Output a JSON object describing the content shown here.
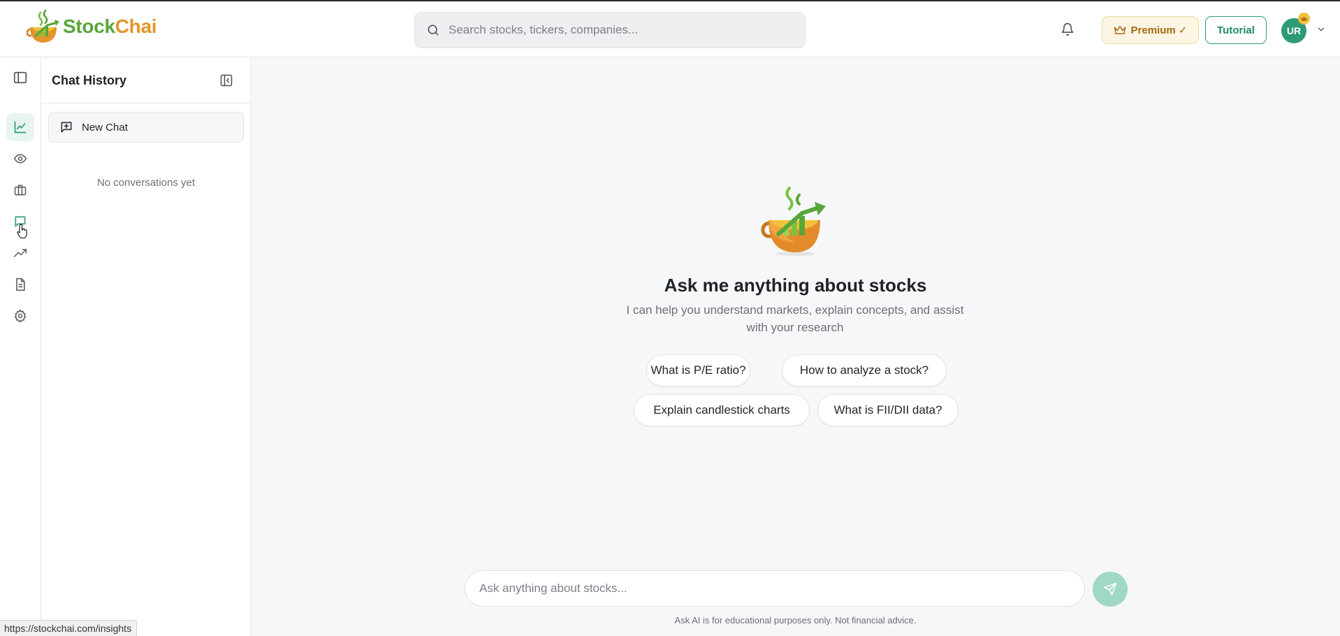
{
  "brand": {
    "name_part1": "Stock",
    "name_part2": "Chai"
  },
  "header": {
    "search_placeholder": "Search stocks, tickers, companies...",
    "premium_label": "Premium ✓",
    "tutorial_label": "Tutorial",
    "avatar_initials": "UR"
  },
  "rail": {
    "items": [
      {
        "icon": "line-chart-icon",
        "active": true
      },
      {
        "icon": "eye-icon",
        "active": false
      },
      {
        "icon": "briefcase-icon",
        "active": false
      },
      {
        "icon": "message-square-icon",
        "active": false,
        "hovered": true
      },
      {
        "icon": "trending-up-icon",
        "active": false
      },
      {
        "icon": "document-icon",
        "active": false
      },
      {
        "icon": "gear-icon",
        "active": false
      }
    ]
  },
  "history": {
    "title": "Chat History",
    "new_chat_label": "New Chat",
    "empty_message": "No conversations yet"
  },
  "main": {
    "title": "Ask me anything about stocks",
    "subtitle": "I can help you understand markets, explain concepts, and assist with your research",
    "suggestions": [
      "What is P/E ratio?",
      "How to analyze a stock?",
      "Explain candlestick charts",
      "What is FII/DII data?"
    ],
    "composer_placeholder": "Ask anything about stocks...",
    "disclaimer": "Ask AI is for educational purposes only. Not financial advice."
  },
  "status_url": "https://stockchai.com/insights",
  "colors": {
    "accent": "#2d9a78",
    "premium": "#a36a12",
    "send_disabled": "#9fd8c3"
  }
}
